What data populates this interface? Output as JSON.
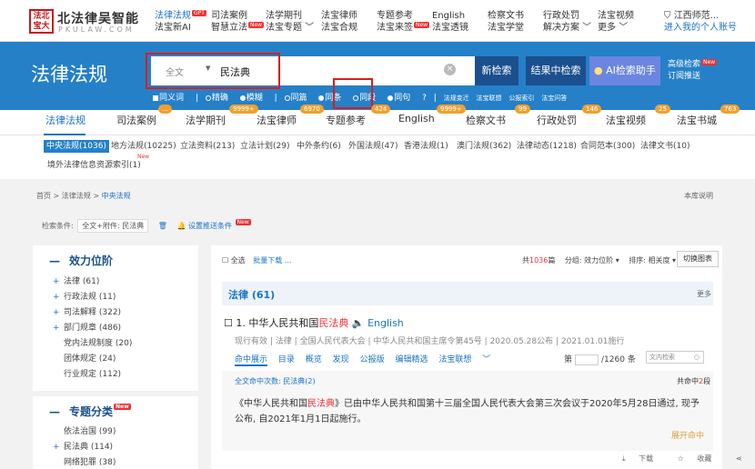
{
  "logo": {
    "seal": "法北宝大",
    "name": "北法律吴智能",
    "en": "PKULAW.COM"
  },
  "nav": [
    {
      "r1": "法律法规",
      "r2": "法宝新AI",
      "badge1": "GPT",
      "badge2": ""
    },
    {
      "r1": "司法案例",
      "r2": "智慧立法",
      "badge1": "",
      "badge2": "New"
    },
    {
      "r1": "法学期刊",
      "r2": "法宝专题",
      "badge1": "",
      "badge2": ""
    },
    {
      "r1": "法宝律师",
      "r2": "法宝合规",
      "badge1": "",
      "badge2": ""
    },
    {
      "r1": "专题参考",
      "r2": "法宝来签",
      "badge1": "",
      "badge2": "New"
    },
    {
      "r1": "English",
      "r2": "法宝透镜",
      "badge1": "",
      "badge2": ""
    },
    {
      "r1": "检察文书",
      "r2": "法宝学堂",
      "badge1": "",
      "badge2": ""
    },
    {
      "r1": "行政处罚",
      "r2": "解决方案",
      "badge1": "",
      "badge2": ""
    },
    {
      "r1": "法宝视频",
      "r2": "更多",
      "badge1": "",
      "badge2": ""
    }
  ],
  "user": {
    "org": "江西师范...",
    "link": "进入我的个人账号"
  },
  "hero": {
    "title": "法律法规"
  },
  "search": {
    "scope": "全文",
    "query": "民法典",
    "clear": "×"
  },
  "buttons": {
    "new_search": "新检索",
    "in_results": "结果中检索",
    "ai": "AI检索助手",
    "advanced": "高级检索",
    "subscribe": "订阅推送",
    "adv_badge": "New"
  },
  "options": {
    "same_word": "同义词",
    "precise": "精确",
    "fuzzy": "模糊",
    "same_piece": "同篇",
    "same_article": "同条",
    "same_paragraph": "同段",
    "same_sentence": "同句",
    "help": "?",
    "links": [
      "法规变迁",
      "法宝联想",
      "公报索引",
      "法宝问答"
    ]
  },
  "categories": [
    {
      "label": "法律法规",
      "count": "..."
    },
    {
      "label": "司法案例",
      "count": ""
    },
    {
      "label": "法学期刊",
      "count": "9999+"
    },
    {
      "label": "法宝律师",
      "count": "6970"
    },
    {
      "label": "专题参考",
      "count": "424"
    },
    {
      "label": "English",
      "count": "9999+"
    },
    {
      "label": "检察文书",
      "count": "99"
    },
    {
      "label": "行政处罚",
      "count": "146"
    },
    {
      "label": "法宝视频",
      "count": "25"
    },
    {
      "label": "法宝书城",
      "count": "763"
    }
  ],
  "subcats": [
    "中央法规(1036)",
    "地方法规(10225)",
    "立法资料(213)",
    "立法计划(29)",
    "中外条约(6)",
    "外国法规(47)",
    "香港法规(1)",
    "澳门法规(362)",
    "法律动态(1218)",
    "合同范本(300)",
    "法律文书(10)",
    "境外法律信息资源索引(1)"
  ],
  "subcat_badge": "New",
  "breadcrumb": {
    "home": "首页",
    "sep": ">",
    "lib": "法律法规",
    "current": "中央法规"
  },
  "help": "本库说明",
  "condition": {
    "label": "检索条件:",
    "value": "全文+附件: 民法典",
    "push": "设置推送条件",
    "badge": "New"
  },
  "effectiveness": {
    "title": "效力位阶",
    "items": [
      {
        "plus": "+",
        "label": "法律 (61)"
      },
      {
        "plus": "+",
        "label": "行政法规 (11)"
      },
      {
        "plus": "+",
        "label": "司法解释 (322)"
      },
      {
        "plus": "+",
        "label": "部门规章 (486)"
      },
      {
        "plus": "",
        "label": "党内法规制度 (20)"
      },
      {
        "plus": "",
        "label": "团体规定 (24)"
      },
      {
        "plus": "",
        "label": "行业规定 (112)"
      }
    ]
  },
  "topics": {
    "title": "专题分类",
    "badge": "New",
    "items": [
      {
        "plus": "",
        "label": "依法治国 (99)"
      },
      {
        "plus": "+",
        "label": "民法典 (114)"
      },
      {
        "plus": "",
        "label": "网络犯罪 (38)"
      }
    ]
  },
  "toolbar": {
    "select_all": "全选",
    "batch": "批量下载",
    "more": "...",
    "total_pre": "共",
    "total_num": "1036",
    "total_post": "篇",
    "group": "分组: 效力位阶",
    "sort": "排序: 相关度",
    "switch": "切换图表"
  },
  "section": {
    "title": "法律 (61)",
    "more": "更多"
  },
  "doc": {
    "index": "1.",
    "title_pre": "中华人民共和国",
    "title_hl": "民法典",
    "english": "English",
    "meta": [
      "现行有效",
      "法律",
      "全国人民代表大会",
      "中华人民共和国主席令第45号",
      "2020.05.28公布",
      "2021.01.01施行"
    ],
    "actions": [
      "命中展示",
      "目录",
      "概览",
      "发现",
      "公报版",
      "编辑精选",
      "法宝联想"
    ],
    "page_pre": "第",
    "page_post": "/1260 条",
    "inner_search": "文内检索",
    "hit_count": "全文命中次数: 民法典(2)",
    "hit_total_pre": "共命中",
    "hit_total_num": "2",
    "hit_total_post": "段",
    "snippet_pre": "《中华人民共和国",
    "snippet_hl": "民法典",
    "snippet_post": "》已由中华人民共和国第十三届全国人民代表大会第三次会议于2020年5月28日通过, 现予公布, 自2021年1月1日起施行。",
    "expand": "展开命中",
    "download": "下载",
    "favorite": "收藏",
    "share": "分享"
  }
}
